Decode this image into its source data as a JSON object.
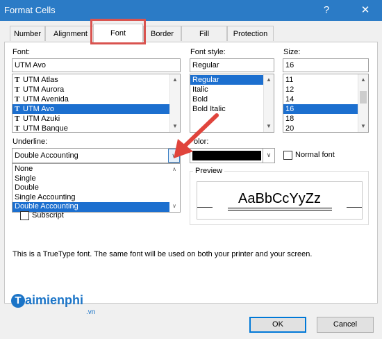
{
  "window": {
    "title": "Format Cells",
    "help": "?",
    "close": "✕"
  },
  "tabs": [
    {
      "label": "Number"
    },
    {
      "label": "Alignment"
    },
    {
      "label": "Font"
    },
    {
      "label": "Border"
    },
    {
      "label": "Fill"
    },
    {
      "label": "Protection"
    }
  ],
  "font": {
    "label": "Font:",
    "value": "UTM Avo",
    "list": [
      {
        "name": "UTM Atlas",
        "selected": false
      },
      {
        "name": "UTM Aurora",
        "selected": false
      },
      {
        "name": "UTM Avenida",
        "selected": false
      },
      {
        "name": "UTM Avo",
        "selected": true
      },
      {
        "name": "UTM Azuki",
        "selected": false
      },
      {
        "name": "UTM Banque",
        "selected": false
      }
    ]
  },
  "font_style": {
    "label": "Font style:",
    "value": "Regular",
    "list": [
      {
        "name": "Regular",
        "selected": true
      },
      {
        "name": "Italic",
        "selected": false
      },
      {
        "name": "Bold",
        "selected": false
      },
      {
        "name": "Bold Italic",
        "selected": false
      }
    ]
  },
  "size": {
    "label": "Size:",
    "value": "16",
    "list": [
      {
        "name": "11",
        "selected": false
      },
      {
        "name": "12",
        "selected": false
      },
      {
        "name": "14",
        "selected": false
      },
      {
        "name": "16",
        "selected": true
      },
      {
        "name": "18",
        "selected": false
      },
      {
        "name": "20",
        "selected": false
      }
    ]
  },
  "underline": {
    "label": "Underline:",
    "value": "Double Accounting",
    "options": [
      {
        "name": "None",
        "selected": false
      },
      {
        "name": "Single",
        "selected": false
      },
      {
        "name": "Double",
        "selected": false
      },
      {
        "name": "Single Accounting",
        "selected": false
      },
      {
        "name": "Double Accounting",
        "selected": true
      }
    ]
  },
  "color": {
    "label": "olor:",
    "swatch": "#000000"
  },
  "normal_font": {
    "label": "Normal font"
  },
  "subscript": {
    "label": "Subscript"
  },
  "preview": {
    "label": "Preview",
    "text": "AaBbCcYyZz"
  },
  "info_text": "This is a TrueType font.  The same font will be used on both your printer and your screen.",
  "watermark": {
    "main": "aimienphi",
    "sub": ".vn"
  },
  "buttons": {
    "ok": "OK",
    "cancel": "Cancel"
  },
  "colors": {
    "titlebar": "#2b7bc6",
    "selection": "#1c6fcf",
    "highlight_box": "#d9534f",
    "arrow": "#e0443c"
  }
}
